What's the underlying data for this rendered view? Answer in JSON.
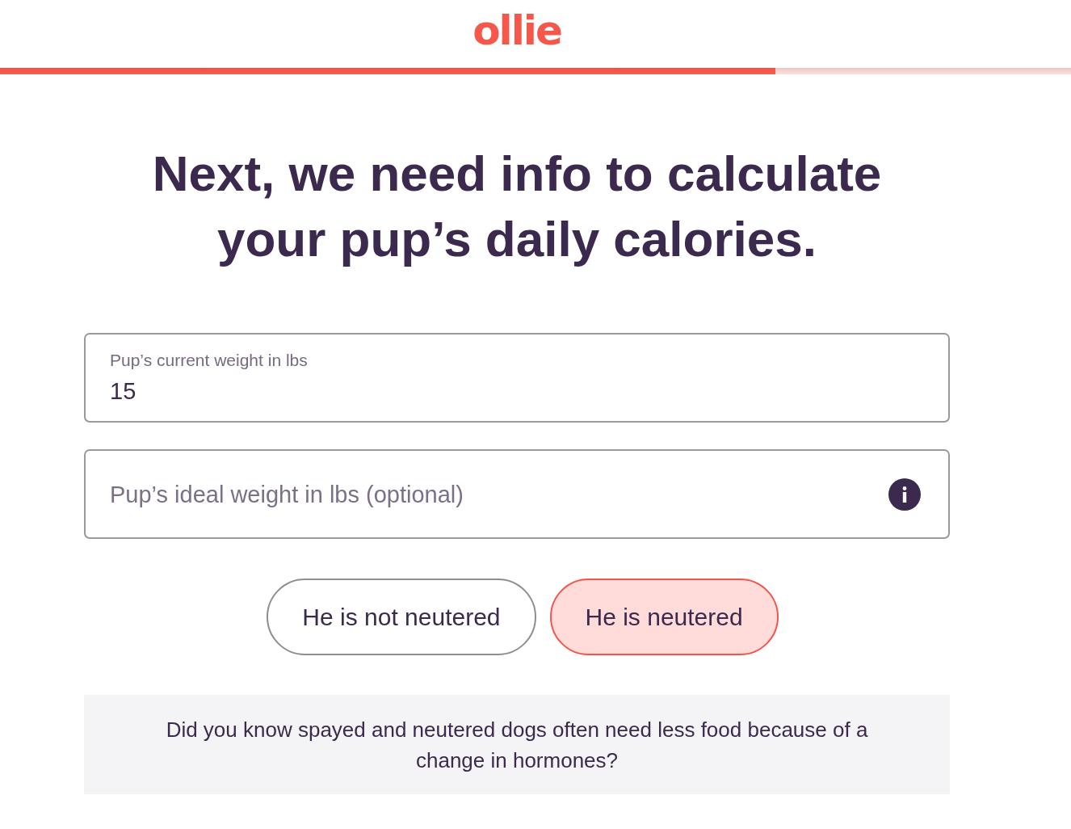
{
  "header": {
    "logo": "ollie"
  },
  "progress": {
    "level": 0.724
  },
  "heading": "Next, we need info to calculate your pup’s daily calories.",
  "fields": [
    {
      "kind": "filled",
      "label": "Pup’s current weight in lbs",
      "value": "15"
    },
    {
      "kind": "empty",
      "placeholder": "Pup’s ideal weight in lbs (optional)",
      "info": true
    }
  ],
  "neuter_options": [
    {
      "label": "He is not neutered",
      "selected": false
    },
    {
      "label": "He is neutered",
      "selected": true
    }
  ],
  "tip": "Did you know spayed and neutered dogs often need less food because of a change in hormones?"
}
